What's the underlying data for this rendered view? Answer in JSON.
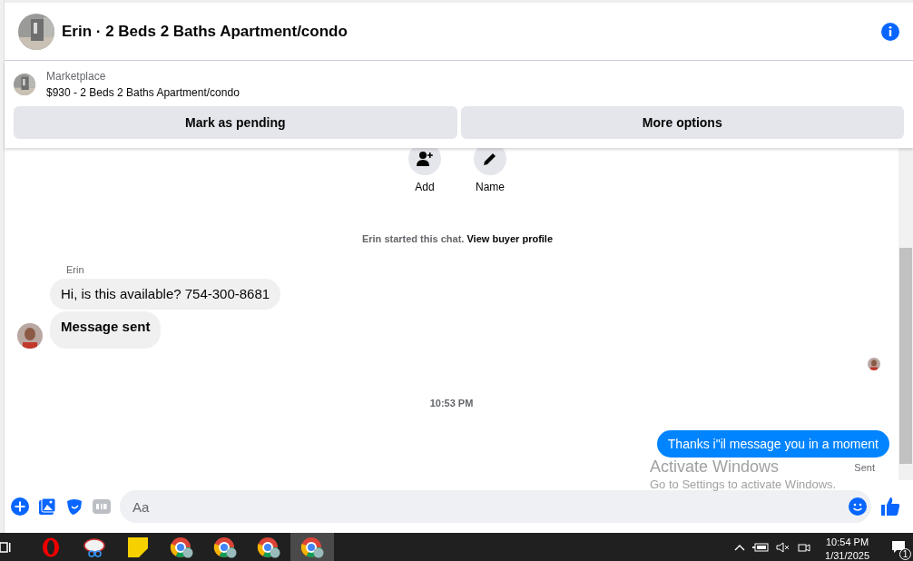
{
  "header": {
    "title": "Erin · 2 Beds 2 Baths Apartment/condo"
  },
  "listing": {
    "source": "Marketplace",
    "title": "$930 - 2 Beds 2 Baths Apartment/condo"
  },
  "actions": [
    "Mark as pending",
    "More options"
  ],
  "contact_actions": [
    {
      "kind": "add",
      "label": "Add"
    },
    {
      "kind": "name",
      "label": "Name"
    }
  ],
  "notice": {
    "text": "Erin started this chat.",
    "link": "View buyer profile"
  },
  "messages": [
    {
      "kind": "sender",
      "text": "Erin"
    },
    {
      "kind": "incoming",
      "text": "Hi, is this available? 754-300-8681",
      "bold": false,
      "avatar": false
    },
    {
      "kind": "incoming",
      "text": "Message sent",
      "bold": true,
      "avatar": true
    },
    {
      "kind": "read_receipt"
    },
    {
      "kind": "timestamp",
      "text": "10:53 PM"
    },
    {
      "kind": "outgoing",
      "text": "Thanks i\"il message you in a moment"
    },
    {
      "kind": "status",
      "text": "Sent"
    }
  ],
  "composer": {
    "placeholder": "Aa"
  },
  "overlay": {
    "title": "Activate Windows",
    "subtitle": "Go to Settings to activate Windows."
  },
  "taskbar": {
    "apps": [
      {
        "kind": "opera",
        "selected": false
      },
      {
        "kind": "snip",
        "selected": false
      },
      {
        "kind": "notes",
        "selected": false
      },
      {
        "kind": "chrome",
        "selected": false
      },
      {
        "kind": "chrome",
        "selected": false
      },
      {
        "kind": "chrome",
        "selected": false
      },
      {
        "kind": "chrome",
        "selected": true
      }
    ],
    "time": "10:54 PM",
    "date": "1/31/2025",
    "notifications": "1"
  }
}
